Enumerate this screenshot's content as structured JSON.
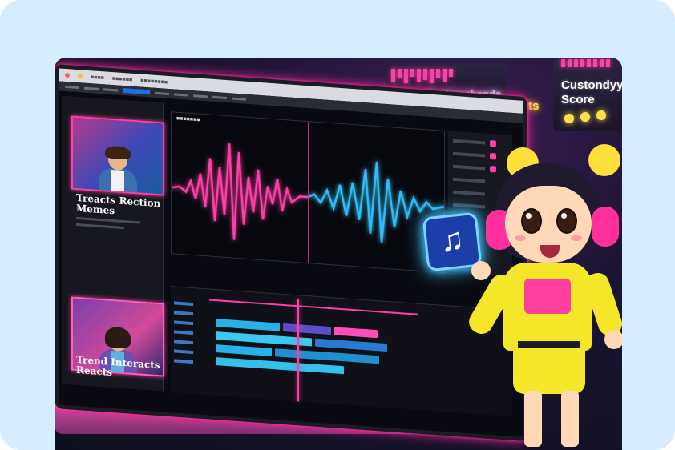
{
  "bg_signs": {
    "custom_bands": "Custmcabands",
    "custom_score_line1": "Custondyy",
    "custom_score_line2": "Score",
    "tits": "Tits"
  },
  "editor": {
    "thumbnails": [
      {
        "title_line1": "Treacts Rection",
        "title_line2": "Memes"
      },
      {
        "title_line1": "Trend Interacts",
        "title_line2": "Reacts"
      }
    ]
  },
  "music_icon": "music-note-icon",
  "colors": {
    "accent_pink": "#ff3fa6",
    "accent_cyan": "#34e1ff",
    "frame_bg": "#d6ecff"
  }
}
